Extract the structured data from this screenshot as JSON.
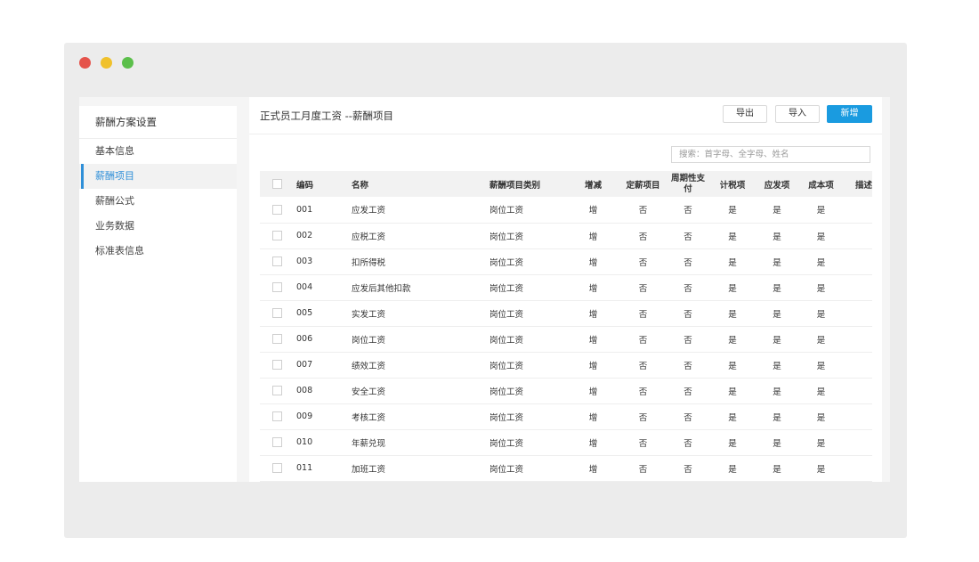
{
  "sidebar": {
    "title": "薪酬方案设置",
    "items": [
      {
        "label": "基本信息"
      },
      {
        "label": "薪酬项目"
      },
      {
        "label": "薪酬公式"
      },
      {
        "label": "业务数据"
      },
      {
        "label": "标准表信息"
      }
    ],
    "active_index": 1
  },
  "header": {
    "title": "正式员工月度工资 --薪酬项目",
    "export_label": "导出",
    "import_label": "导入",
    "add_label": "新增"
  },
  "search": {
    "placeholder": "搜索：首字母、全字母、姓名"
  },
  "table": {
    "columns": [
      "编码",
      "名称",
      "薪酬项目类别",
      "增减",
      "定薪项目",
      "周期性支付",
      "计税项",
      "应发项",
      "成本项",
      "描述"
    ],
    "rows": [
      [
        "001",
        "应发工资",
        "岗位工资",
        "增",
        "否",
        "否",
        "是",
        "是",
        "是"
      ],
      [
        "002",
        "应税工资",
        "岗位工资",
        "增",
        "否",
        "否",
        "是",
        "是",
        "是"
      ],
      [
        "003",
        "扣所得税",
        "岗位工资",
        "增",
        "否",
        "否",
        "是",
        "是",
        "是"
      ],
      [
        "004",
        "应发后其他扣款",
        "岗位工资",
        "增",
        "否",
        "否",
        "是",
        "是",
        "是"
      ],
      [
        "005",
        "实发工资",
        "岗位工资",
        "增",
        "否",
        "否",
        "是",
        "是",
        "是"
      ],
      [
        "006",
        "岗位工资",
        "岗位工资",
        "增",
        "否",
        "否",
        "是",
        "是",
        "是"
      ],
      [
        "007",
        "绩效工资",
        "岗位工资",
        "增",
        "否",
        "否",
        "是",
        "是",
        "是"
      ],
      [
        "008",
        "安全工资",
        "岗位工资",
        "增",
        "否",
        "否",
        "是",
        "是",
        "是"
      ],
      [
        "009",
        "考核工资",
        "岗位工资",
        "增",
        "否",
        "否",
        "是",
        "是",
        "是"
      ],
      [
        "010",
        "年薪兑现",
        "岗位工资",
        "增",
        "否",
        "否",
        "是",
        "是",
        "是"
      ],
      [
        "011",
        "加班工资",
        "岗位工资",
        "增",
        "否",
        "否",
        "是",
        "是",
        "是"
      ]
    ]
  },
  "colors": {
    "accent": "#1a9be0",
    "window_dots": [
      "#e5534b",
      "#f0c12b",
      "#5bbf4a"
    ]
  }
}
